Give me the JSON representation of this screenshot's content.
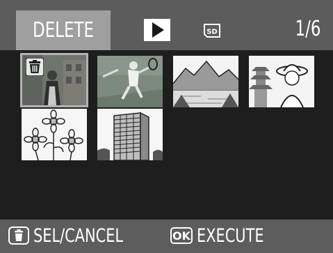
{
  "topbar": {
    "mode_label": "DELETE",
    "play_icon": "play-icon",
    "media_icon": "sd-card-icon",
    "media_label": "SD",
    "counter": "1/6"
  },
  "thumbnails": [
    {
      "subject": "woman-in-front-of-building",
      "selected": true,
      "marked_for_delete": true
    },
    {
      "subject": "tennis-player",
      "selected": false,
      "marked_for_delete": false
    },
    {
      "subject": "mountain-lake",
      "selected": false,
      "marked_for_delete": false
    },
    {
      "subject": "woman-with-hat-and-pagoda",
      "selected": false,
      "marked_for_delete": false
    },
    {
      "subject": "flowers",
      "selected": false,
      "marked_for_delete": false
    },
    {
      "subject": "apartment-building",
      "selected": false,
      "marked_for_delete": false
    }
  ],
  "bottombar": {
    "sel_icon": "trash-icon",
    "sel_label": "SEL/CANCEL",
    "ok_icon": "ok-button-icon",
    "ok_badge": "OK",
    "ok_label": "EXECUTE"
  },
  "colors": {
    "bar": "#5c5c5c",
    "tab": "#9f9f9f",
    "background": "#1e1e1e",
    "text": "#ffffff"
  }
}
